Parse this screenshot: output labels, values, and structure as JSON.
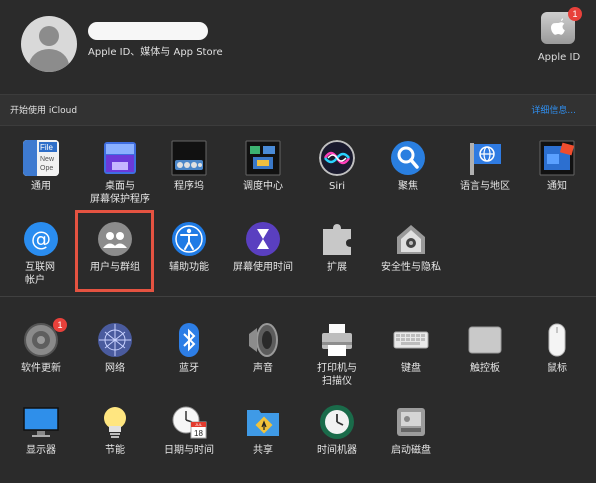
{
  "header": {
    "apple_id_subtitle": "Apple ID、媒体与 App Store",
    "apple_id_button_label": "Apple ID",
    "apple_id_badge": "1"
  },
  "icloud": {
    "prompt": "开始使用 iCloud",
    "link": "详细信息..."
  },
  "section1": [
    {
      "label": "通用",
      "icon": "general-icon"
    },
    {
      "label": "桌面与\n屏幕保护程序",
      "icon": "desktop-screensaver-icon"
    },
    {
      "label": "程序坞",
      "icon": "dock-icon"
    },
    {
      "label": "调度中心",
      "icon": "mission-control-icon"
    },
    {
      "label": "Siri",
      "icon": "siri-icon"
    },
    {
      "label": "聚焦",
      "icon": "spotlight-icon"
    },
    {
      "label": "语言与地区",
      "icon": "language-region-icon"
    },
    {
      "label": "通知",
      "icon": "notifications-icon"
    },
    {
      "label": "互联网\n帐户",
      "icon": "internet-accounts-icon"
    },
    {
      "label": "用户与群组",
      "icon": "users-groups-icon"
    },
    {
      "label": "辅助功能",
      "icon": "accessibility-icon"
    },
    {
      "label": "屏幕使用时间",
      "icon": "screen-time-icon"
    },
    {
      "label": "扩展",
      "icon": "extensions-icon"
    },
    {
      "label": "安全性与隐私",
      "icon": "security-privacy-icon"
    }
  ],
  "section2": [
    {
      "label": "软件更新",
      "icon": "software-update-icon",
      "badge": "1"
    },
    {
      "label": "网络",
      "icon": "network-icon"
    },
    {
      "label": "蓝牙",
      "icon": "bluetooth-icon"
    },
    {
      "label": "声音",
      "icon": "sound-icon"
    },
    {
      "label": "打印机与\n扫描仪",
      "icon": "printers-scanners-icon"
    },
    {
      "label": "键盘",
      "icon": "keyboard-icon"
    },
    {
      "label": "触控板",
      "icon": "trackpad-icon"
    },
    {
      "label": "鼠标",
      "icon": "mouse-icon"
    },
    {
      "label": "显示器",
      "icon": "displays-icon"
    },
    {
      "label": "节能",
      "icon": "energy-saver-icon"
    },
    {
      "label": "日期与时间",
      "icon": "date-time-icon"
    },
    {
      "label": "共享",
      "icon": "sharing-icon"
    },
    {
      "label": "时间机器",
      "icon": "time-machine-icon"
    },
    {
      "label": "启动磁盘",
      "icon": "startup-disk-icon"
    }
  ],
  "calendar_icon": {
    "month": "JUL",
    "day": "18"
  }
}
